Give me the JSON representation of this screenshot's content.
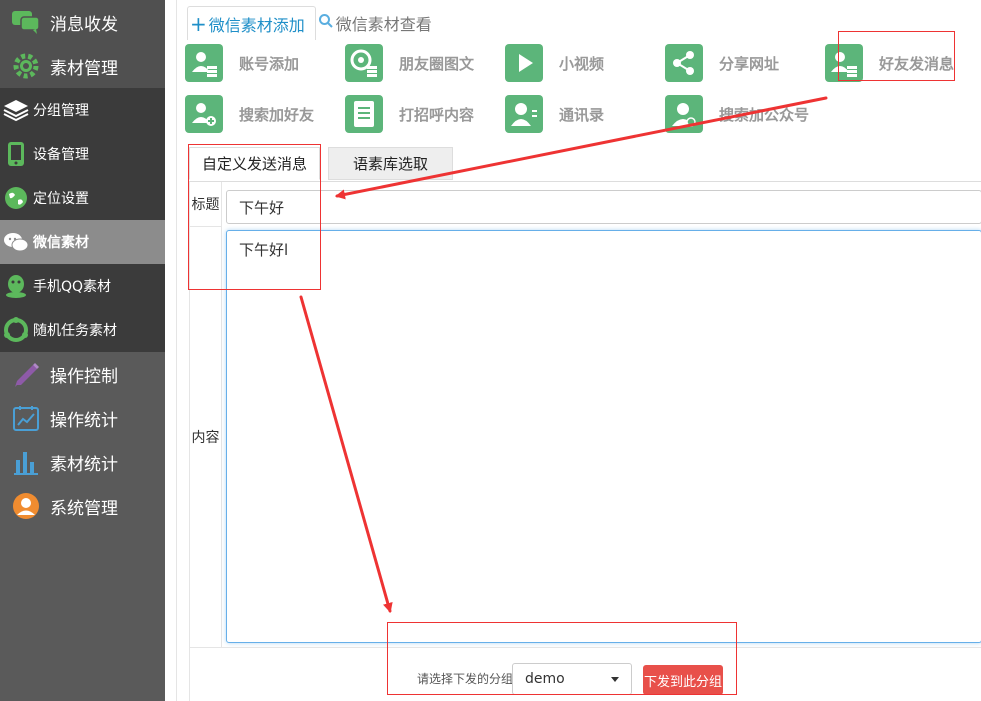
{
  "sidebar": {
    "items": [
      {
        "label": "消息收发",
        "icon": "chat-bubbles-icon",
        "kind": "main"
      },
      {
        "label": "素材管理",
        "icon": "gear-icon",
        "kind": "main"
      },
      {
        "label": "分组管理",
        "icon": "layers-icon",
        "kind": "sub"
      },
      {
        "label": "设备管理",
        "icon": "phone-icon",
        "kind": "sub"
      },
      {
        "label": "定位设置",
        "icon": "globe-icon",
        "kind": "sub"
      },
      {
        "label": "微信素材",
        "icon": "wechat-icon",
        "kind": "sub",
        "active": true
      },
      {
        "label": "手机QQ素材",
        "icon": "qq-icon",
        "kind": "sub"
      },
      {
        "label": "随机任务素材",
        "icon": "random-icon",
        "kind": "sub"
      },
      {
        "label": "操作控制",
        "icon": "pencil-icon",
        "kind": "main"
      },
      {
        "label": "操作统计",
        "icon": "line-chart-icon",
        "kind": "main"
      },
      {
        "label": "素材统计",
        "icon": "bar-chart-icon",
        "kind": "main"
      },
      {
        "label": "系统管理",
        "icon": "user-circle-icon",
        "kind": "main"
      }
    ]
  },
  "top_tabs": {
    "add": "微信素材添加",
    "view": "微信素材查看"
  },
  "tools": [
    {
      "label": "账号添加",
      "icon": "account-add-icon"
    },
    {
      "label": "朋友圈图文",
      "icon": "moments-icon"
    },
    {
      "label": "小视频",
      "icon": "play-icon"
    },
    {
      "label": "分享网址",
      "icon": "share-icon"
    },
    {
      "label": "好友发消息",
      "icon": "friend-message-icon"
    },
    {
      "label": "搜索加好友",
      "icon": "search-add-friend-icon"
    },
    {
      "label": "打招呼内容",
      "icon": "document-icon"
    },
    {
      "label": "通讯录",
      "icon": "contacts-icon"
    },
    {
      "label": "搜索加公众号",
      "icon": "search-official-account-icon"
    }
  ],
  "sub_tabs": {
    "custom": "自定义发送消息",
    "library": "语素库选取"
  },
  "form": {
    "title_label": "标题",
    "title_value": "下午好",
    "content_label": "内容",
    "content_value": "下午好l"
  },
  "bottom": {
    "group_label": "请选择下发的分组",
    "group_value": "demo",
    "send_button": "下发到此分组"
  },
  "colors": {
    "sidebar_bg": "#5a5a5a",
    "sidebar_sub_bg": "#3b3b3b",
    "tool_icon_green": "#5cb57a",
    "accent_blue": "#1f8fc8",
    "send_button_red": "#e8504a",
    "annotation_red": "#e33333"
  }
}
